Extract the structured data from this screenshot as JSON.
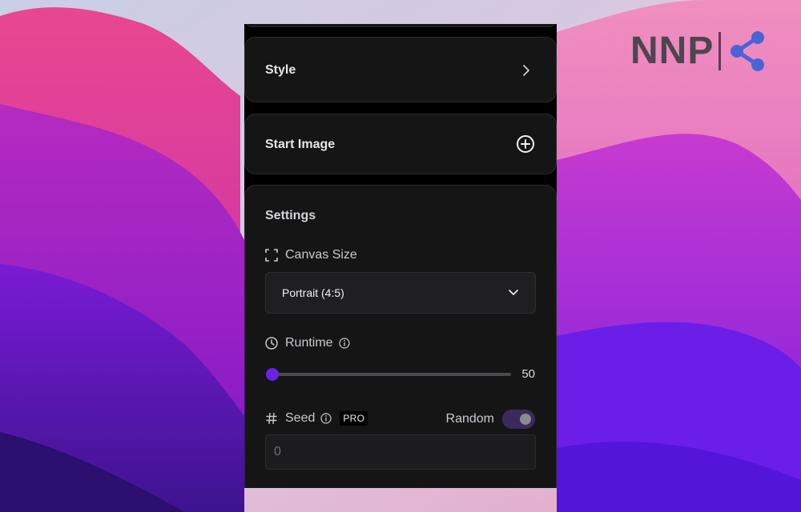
{
  "brand": {
    "text": "NNP",
    "color": "#4d4550",
    "share_icon_color": "#4a64d8"
  },
  "panel": {
    "style_card": {
      "title": "Style"
    },
    "start_image_card": {
      "title": "Start Image"
    },
    "settings": {
      "title": "Settings",
      "canvas_size": {
        "label": "Canvas Size",
        "icon": "expand-frame-icon",
        "selected": "Portrait (4:5)"
      },
      "runtime": {
        "label": "Runtime",
        "icon": "clock-icon",
        "value": 50,
        "value_label": "50",
        "min": 50,
        "max": 500
      },
      "seed": {
        "label": "Seed",
        "icon": "hash-icon",
        "badge": "PRO",
        "random_label": "Random",
        "random_enabled": true,
        "placeholder": "0"
      }
    }
  },
  "colors": {
    "accent": "#6a22e6",
    "card_bg": "#151515",
    "panel_bg": "#000000"
  }
}
